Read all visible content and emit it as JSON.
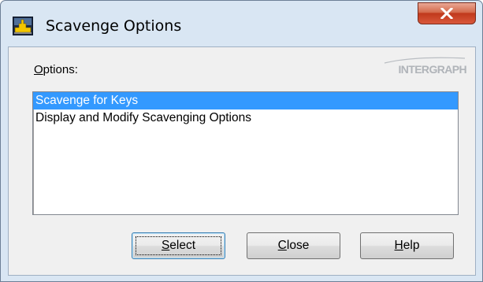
{
  "window": {
    "title": "Scavenge Options",
    "close_glyph": "X",
    "app_icon": "scavenge-app-icon"
  },
  "dialog": {
    "options_label_accel": "O",
    "options_label_rest": "ptions:",
    "brand": "INTERGRAPH"
  },
  "list": {
    "items": [
      {
        "label": "Scavenge for Keys",
        "selected": true
      },
      {
        "label": "Display and Modify Scavenging Options",
        "selected": false
      }
    ]
  },
  "buttons": {
    "select": {
      "accel": "S",
      "rest": "elect"
    },
    "close": {
      "accel": "C",
      "rest": "lose"
    },
    "help": {
      "accel": "H",
      "rest": "elp"
    }
  },
  "colors": {
    "selection": "#3399ff",
    "title_bar": "#d9e6f3",
    "close_button": "#c0391c"
  }
}
